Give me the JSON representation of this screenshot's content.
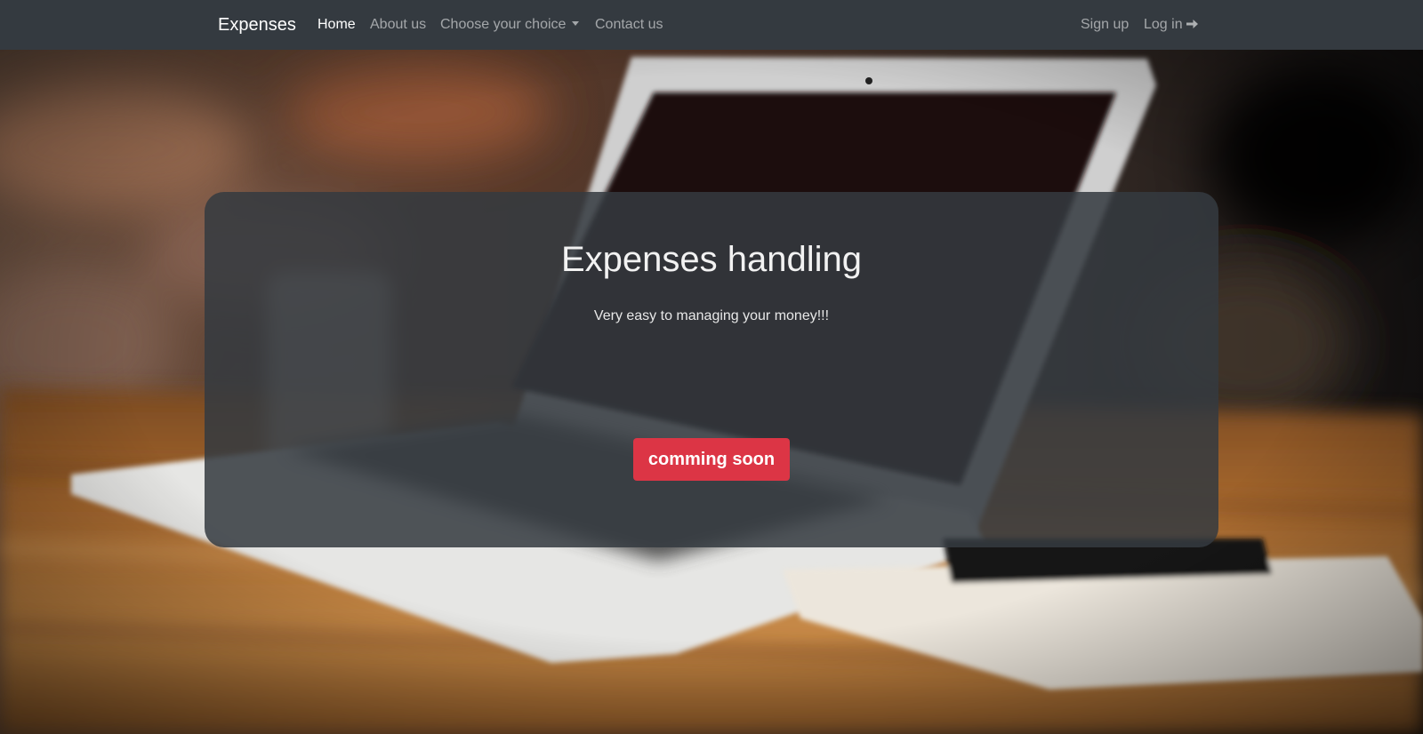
{
  "navbar": {
    "brand": "Expenses",
    "links": [
      {
        "label": "Home",
        "active": true
      },
      {
        "label": "About us",
        "active": false
      },
      {
        "label": "Choose your choice",
        "active": false,
        "dropdown": true
      },
      {
        "label": "Contact us",
        "active": false
      }
    ],
    "right_links": [
      {
        "label": "Sign up"
      },
      {
        "label": "Log in",
        "icon": "arrow-right-icon"
      }
    ]
  },
  "hero": {
    "title": "Expenses handling",
    "subtitle": "Very easy to managing your money!!!",
    "cta_label": "comming soon"
  },
  "colors": {
    "navbar_bg": "#343a40",
    "cta_bg": "#dc3545",
    "panel_bg": "rgba(52,58,64,0.86)"
  }
}
